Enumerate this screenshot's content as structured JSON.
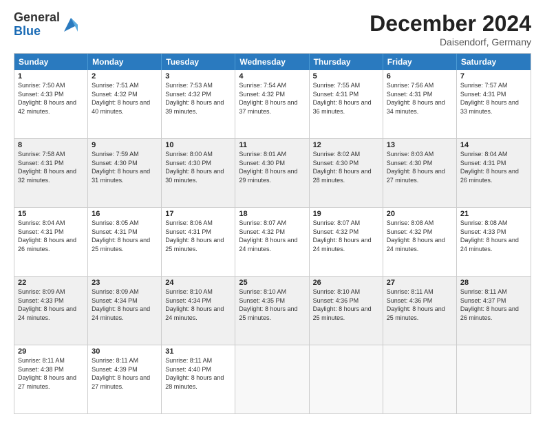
{
  "logo": {
    "general": "General",
    "blue": "Blue"
  },
  "title": "December 2024",
  "location": "Daisendorf, Germany",
  "days_of_week": [
    "Sunday",
    "Monday",
    "Tuesday",
    "Wednesday",
    "Thursday",
    "Friday",
    "Saturday"
  ],
  "weeks": [
    [
      {
        "day": "1",
        "sunrise": "Sunrise: 7:50 AM",
        "sunset": "Sunset: 4:33 PM",
        "daylight": "Daylight: 8 hours and 42 minutes.",
        "shaded": false
      },
      {
        "day": "2",
        "sunrise": "Sunrise: 7:51 AM",
        "sunset": "Sunset: 4:32 PM",
        "daylight": "Daylight: 8 hours and 40 minutes.",
        "shaded": false
      },
      {
        "day": "3",
        "sunrise": "Sunrise: 7:53 AM",
        "sunset": "Sunset: 4:32 PM",
        "daylight": "Daylight: 8 hours and 39 minutes.",
        "shaded": false
      },
      {
        "day": "4",
        "sunrise": "Sunrise: 7:54 AM",
        "sunset": "Sunset: 4:32 PM",
        "daylight": "Daylight: 8 hours and 37 minutes.",
        "shaded": false
      },
      {
        "day": "5",
        "sunrise": "Sunrise: 7:55 AM",
        "sunset": "Sunset: 4:31 PM",
        "daylight": "Daylight: 8 hours and 36 minutes.",
        "shaded": false
      },
      {
        "day": "6",
        "sunrise": "Sunrise: 7:56 AM",
        "sunset": "Sunset: 4:31 PM",
        "daylight": "Daylight: 8 hours and 34 minutes.",
        "shaded": false
      },
      {
        "day": "7",
        "sunrise": "Sunrise: 7:57 AM",
        "sunset": "Sunset: 4:31 PM",
        "daylight": "Daylight: 8 hours and 33 minutes.",
        "shaded": false
      }
    ],
    [
      {
        "day": "8",
        "sunrise": "Sunrise: 7:58 AM",
        "sunset": "Sunset: 4:31 PM",
        "daylight": "Daylight: 8 hours and 32 minutes.",
        "shaded": true
      },
      {
        "day": "9",
        "sunrise": "Sunrise: 7:59 AM",
        "sunset": "Sunset: 4:30 PM",
        "daylight": "Daylight: 8 hours and 31 minutes.",
        "shaded": true
      },
      {
        "day": "10",
        "sunrise": "Sunrise: 8:00 AM",
        "sunset": "Sunset: 4:30 PM",
        "daylight": "Daylight: 8 hours and 30 minutes.",
        "shaded": true
      },
      {
        "day": "11",
        "sunrise": "Sunrise: 8:01 AM",
        "sunset": "Sunset: 4:30 PM",
        "daylight": "Daylight: 8 hours and 29 minutes.",
        "shaded": true
      },
      {
        "day": "12",
        "sunrise": "Sunrise: 8:02 AM",
        "sunset": "Sunset: 4:30 PM",
        "daylight": "Daylight: 8 hours and 28 minutes.",
        "shaded": true
      },
      {
        "day": "13",
        "sunrise": "Sunrise: 8:03 AM",
        "sunset": "Sunset: 4:30 PM",
        "daylight": "Daylight: 8 hours and 27 minutes.",
        "shaded": true
      },
      {
        "day": "14",
        "sunrise": "Sunrise: 8:04 AM",
        "sunset": "Sunset: 4:31 PM",
        "daylight": "Daylight: 8 hours and 26 minutes.",
        "shaded": true
      }
    ],
    [
      {
        "day": "15",
        "sunrise": "Sunrise: 8:04 AM",
        "sunset": "Sunset: 4:31 PM",
        "daylight": "Daylight: 8 hours and 26 minutes.",
        "shaded": false
      },
      {
        "day": "16",
        "sunrise": "Sunrise: 8:05 AM",
        "sunset": "Sunset: 4:31 PM",
        "daylight": "Daylight: 8 hours and 25 minutes.",
        "shaded": false
      },
      {
        "day": "17",
        "sunrise": "Sunrise: 8:06 AM",
        "sunset": "Sunset: 4:31 PM",
        "daylight": "Daylight: 8 hours and 25 minutes.",
        "shaded": false
      },
      {
        "day": "18",
        "sunrise": "Sunrise: 8:07 AM",
        "sunset": "Sunset: 4:32 PM",
        "daylight": "Daylight: 8 hours and 24 minutes.",
        "shaded": false
      },
      {
        "day": "19",
        "sunrise": "Sunrise: 8:07 AM",
        "sunset": "Sunset: 4:32 PM",
        "daylight": "Daylight: 8 hours and 24 minutes.",
        "shaded": false
      },
      {
        "day": "20",
        "sunrise": "Sunrise: 8:08 AM",
        "sunset": "Sunset: 4:32 PM",
        "daylight": "Daylight: 8 hours and 24 minutes.",
        "shaded": false
      },
      {
        "day": "21",
        "sunrise": "Sunrise: 8:08 AM",
        "sunset": "Sunset: 4:33 PM",
        "daylight": "Daylight: 8 hours and 24 minutes.",
        "shaded": false
      }
    ],
    [
      {
        "day": "22",
        "sunrise": "Sunrise: 8:09 AM",
        "sunset": "Sunset: 4:33 PM",
        "daylight": "Daylight: 8 hours and 24 minutes.",
        "shaded": true
      },
      {
        "day": "23",
        "sunrise": "Sunrise: 8:09 AM",
        "sunset": "Sunset: 4:34 PM",
        "daylight": "Daylight: 8 hours and 24 minutes.",
        "shaded": true
      },
      {
        "day": "24",
        "sunrise": "Sunrise: 8:10 AM",
        "sunset": "Sunset: 4:34 PM",
        "daylight": "Daylight: 8 hours and 24 minutes.",
        "shaded": true
      },
      {
        "day": "25",
        "sunrise": "Sunrise: 8:10 AM",
        "sunset": "Sunset: 4:35 PM",
        "daylight": "Daylight: 8 hours and 25 minutes.",
        "shaded": true
      },
      {
        "day": "26",
        "sunrise": "Sunrise: 8:10 AM",
        "sunset": "Sunset: 4:36 PM",
        "daylight": "Daylight: 8 hours and 25 minutes.",
        "shaded": true
      },
      {
        "day": "27",
        "sunrise": "Sunrise: 8:11 AM",
        "sunset": "Sunset: 4:36 PM",
        "daylight": "Daylight: 8 hours and 25 minutes.",
        "shaded": true
      },
      {
        "day": "28",
        "sunrise": "Sunrise: 8:11 AM",
        "sunset": "Sunset: 4:37 PM",
        "daylight": "Daylight: 8 hours and 26 minutes.",
        "shaded": true
      }
    ],
    [
      {
        "day": "29",
        "sunrise": "Sunrise: 8:11 AM",
        "sunset": "Sunset: 4:38 PM",
        "daylight": "Daylight: 8 hours and 27 minutes.",
        "shaded": false
      },
      {
        "day": "30",
        "sunrise": "Sunrise: 8:11 AM",
        "sunset": "Sunset: 4:39 PM",
        "daylight": "Daylight: 8 hours and 27 minutes.",
        "shaded": false
      },
      {
        "day": "31",
        "sunrise": "Sunrise: 8:11 AM",
        "sunset": "Sunset: 4:40 PM",
        "daylight": "Daylight: 8 hours and 28 minutes.",
        "shaded": false
      },
      {
        "day": "",
        "sunrise": "",
        "sunset": "",
        "daylight": "",
        "shaded": false,
        "empty": true
      },
      {
        "day": "",
        "sunrise": "",
        "sunset": "",
        "daylight": "",
        "shaded": false,
        "empty": true
      },
      {
        "day": "",
        "sunrise": "",
        "sunset": "",
        "daylight": "",
        "shaded": false,
        "empty": true
      },
      {
        "day": "",
        "sunrise": "",
        "sunset": "",
        "daylight": "",
        "shaded": false,
        "empty": true
      }
    ]
  ]
}
